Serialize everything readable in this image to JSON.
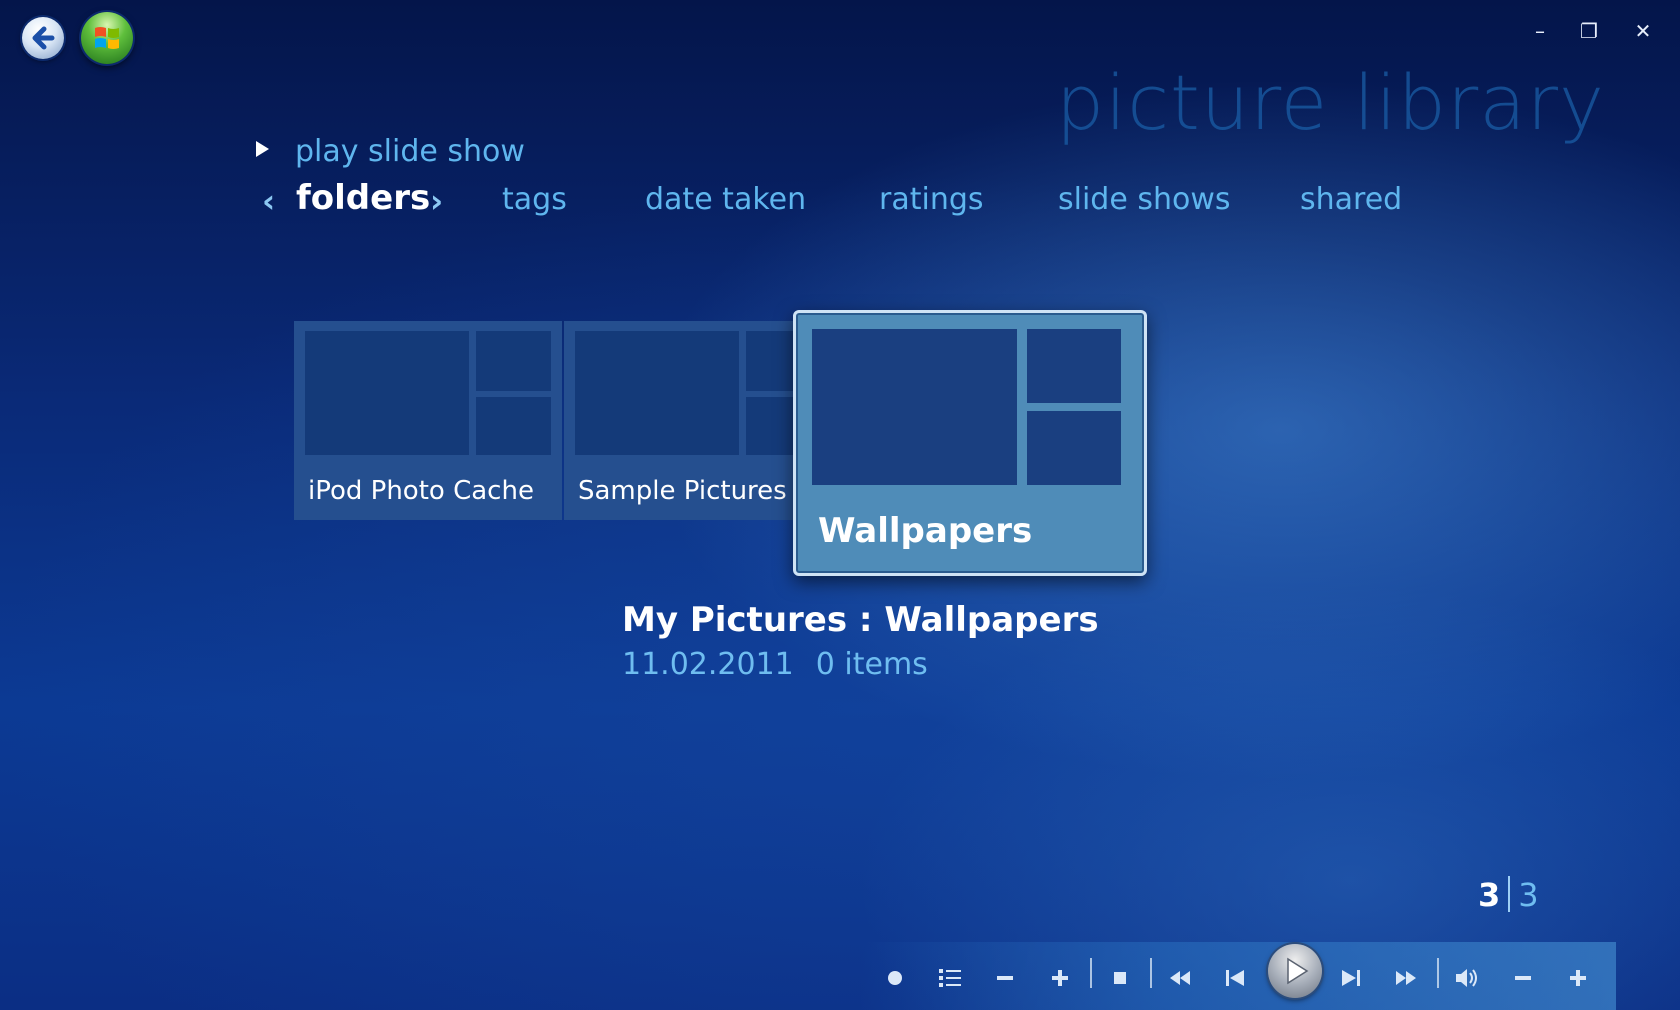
{
  "window": {
    "title": "picture library",
    "controls": {
      "minimize": "–",
      "restore": "❐",
      "close": "✕"
    }
  },
  "icons": {
    "back": "back-arrow-icon",
    "start": "windows-logo-icon",
    "play_slideshow": "play-triangle-icon"
  },
  "actions": {
    "play_slide_show": "play slide show"
  },
  "nav": {
    "prev": "‹",
    "next": "›",
    "active": "folders",
    "items": [
      "tags",
      "date taken",
      "ratings",
      "slide shows",
      "shared"
    ]
  },
  "folders": [
    {
      "label": "iPod Photo Cache"
    },
    {
      "label": "Sample Pictures"
    },
    {
      "label": "Wallpapers"
    }
  ],
  "selection": {
    "title": "My Pictures : Wallpapers",
    "date": "11.02.2011",
    "items": "0 items"
  },
  "pager": {
    "current": "3",
    "total": "3"
  },
  "transport": {
    "buttons": [
      "record",
      "guide",
      "channel-down",
      "channel-up",
      "stop",
      "rewind",
      "previous",
      "play",
      "next",
      "fast-forward",
      "mute",
      "volume-down",
      "volume-up"
    ]
  },
  "colors": {
    "accent": "#5fb6ee",
    "background": "#0c3a94",
    "title": "#1a5fa8"
  }
}
